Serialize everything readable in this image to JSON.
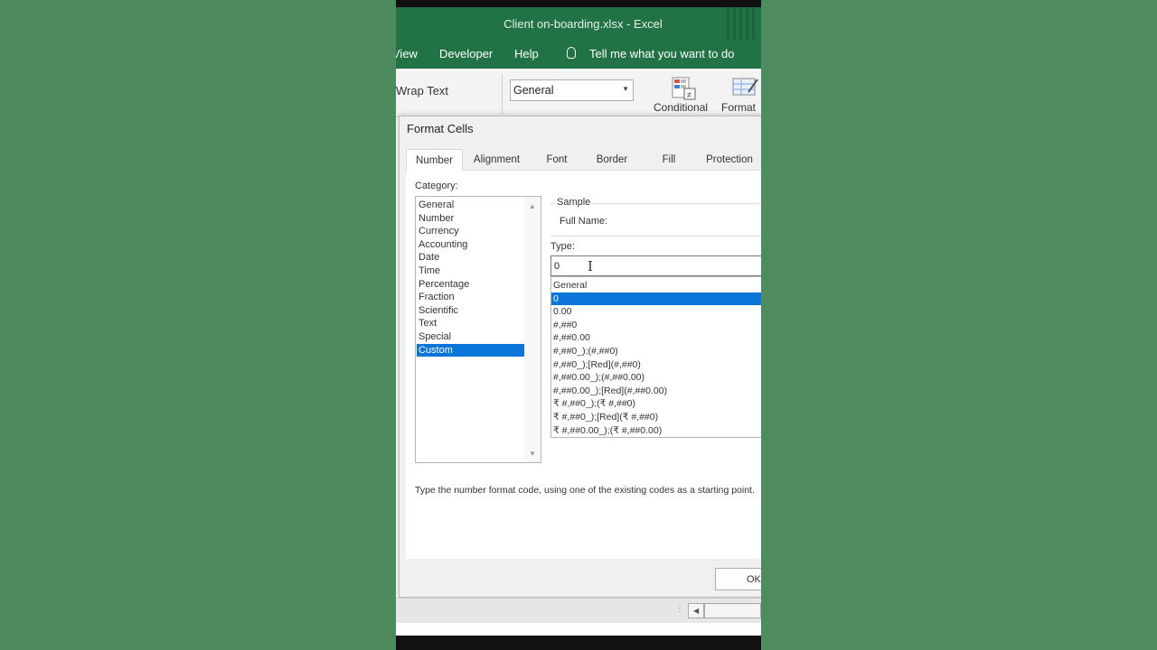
{
  "window": {
    "title": "Client on-boarding.xlsx  -  Excel"
  },
  "menu": {
    "view": "View",
    "developer": "Developer",
    "help": "Help",
    "tell_me": "Tell me what you want to do"
  },
  "ribbon": {
    "wrap_text": "Wrap Text",
    "number_format": "General",
    "conditional": "Conditional",
    "format_as": "Format"
  },
  "dialog": {
    "title": "Format Cells",
    "tabs": [
      "Number",
      "Alignment",
      "Font",
      "Border",
      "Fill",
      "Protection"
    ],
    "category_label": "Category:",
    "categories": [
      "General",
      "Number",
      "Currency",
      "Accounting",
      "Date",
      "Time",
      "Percentage",
      "Fraction",
      "Scientific",
      "Text",
      "Special",
      "Custom"
    ],
    "selected_category": "Custom",
    "sample_label": "Sample",
    "sample_value": "Full Name:",
    "type_label": "Type:",
    "type_value": "0",
    "type_list": [
      "General",
      "0",
      "0.00",
      "#,##0",
      "#,##0.00",
      "#,##0_);(#,##0)",
      "#,##0_);[Red](#,##0)",
      "#,##0.00_);(#,##0.00)",
      "#,##0.00_);[Red](#,##0.00)",
      "₹ #,##0_);(₹ #,##0)",
      "₹ #,##0_);[Red](₹ #,##0)",
      "₹ #,##0.00_);(₹ #,##0.00)"
    ],
    "selected_type": "0",
    "hint": "Type the number format code, using one of the existing codes as a starting point.",
    "ok": "OK"
  }
}
